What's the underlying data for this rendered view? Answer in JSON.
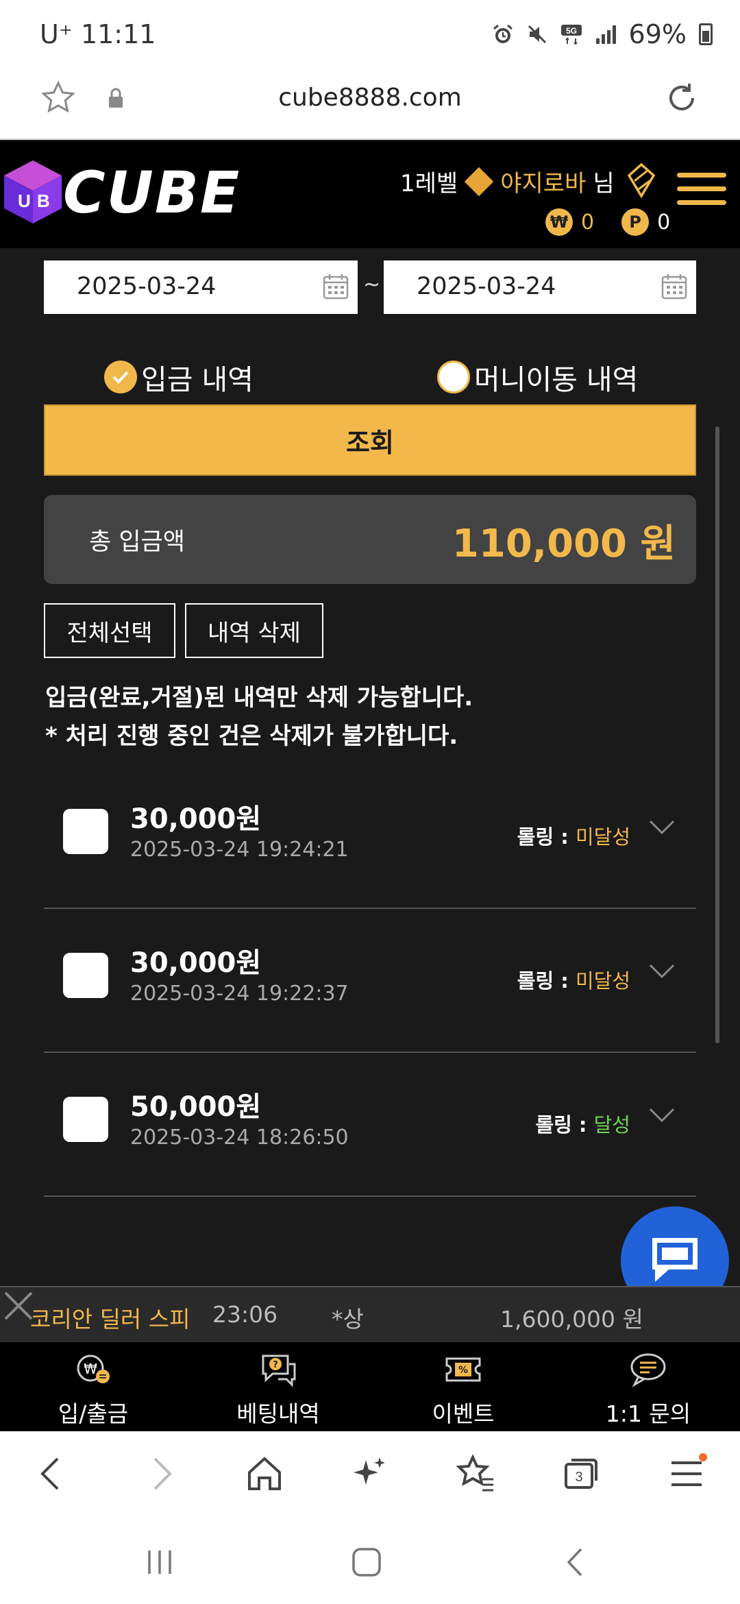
{
  "status": {
    "carrier": "U⁺ 11:11",
    "battery": "69%"
  },
  "browser": {
    "url": "cube8888.com",
    "tab_count": "3"
  },
  "header": {
    "logo": "CUBE",
    "level": "1레벨",
    "nickname": "야지로바",
    "suffix": "님",
    "won_symbol": "₩",
    "won_balance": "0",
    "point_symbol": "P",
    "point_balance": "0"
  },
  "filter": {
    "date_from": "2025-03-24",
    "date_to": "2025-03-24",
    "separator": "~",
    "radio_deposit": "입금 내역",
    "radio_money": "머니이동 내역",
    "search_button": "조회"
  },
  "summary": {
    "label": "총 입금액",
    "amount": "110,000 원"
  },
  "actions": {
    "select_all": "전체선택",
    "delete": "내역 삭제"
  },
  "notice": {
    "line1": "입금(완료,거절)된 내역만 삭제 가능합니다.",
    "line2": "* 처리 진행 중인 건은 삭제가 불가합니다."
  },
  "records": [
    {
      "amount": "30,000원",
      "time": "2025-03-24 19:24:21",
      "rolling_label": "롤링 :",
      "rolling_value": "미달성"
    },
    {
      "amount": "30,000원",
      "time": "2025-03-24 19:22:37",
      "rolling_label": "롤링 :",
      "rolling_value": "미달성"
    },
    {
      "amount": "50,000원",
      "time": "2025-03-24 18:26:50",
      "rolling_label": "롤링 :",
      "rolling_value": "달성"
    }
  ],
  "ticker": {
    "game": "코리안 딜러 스피",
    "time": "23:06",
    "user": "*상",
    "amount": "1,600,000 원"
  },
  "site_nav": [
    {
      "label": "입/출금",
      "icon": "deposit-icon"
    },
    {
      "label": "베팅내역",
      "icon": "betting-icon"
    },
    {
      "label": "이벤트",
      "icon": "ticket-icon"
    },
    {
      "label": "1:1 문의",
      "icon": "chat-icon"
    }
  ],
  "colors": {
    "accent": "#f2b84b",
    "achieved": "#6fd35a",
    "chat": "#2262d8"
  }
}
